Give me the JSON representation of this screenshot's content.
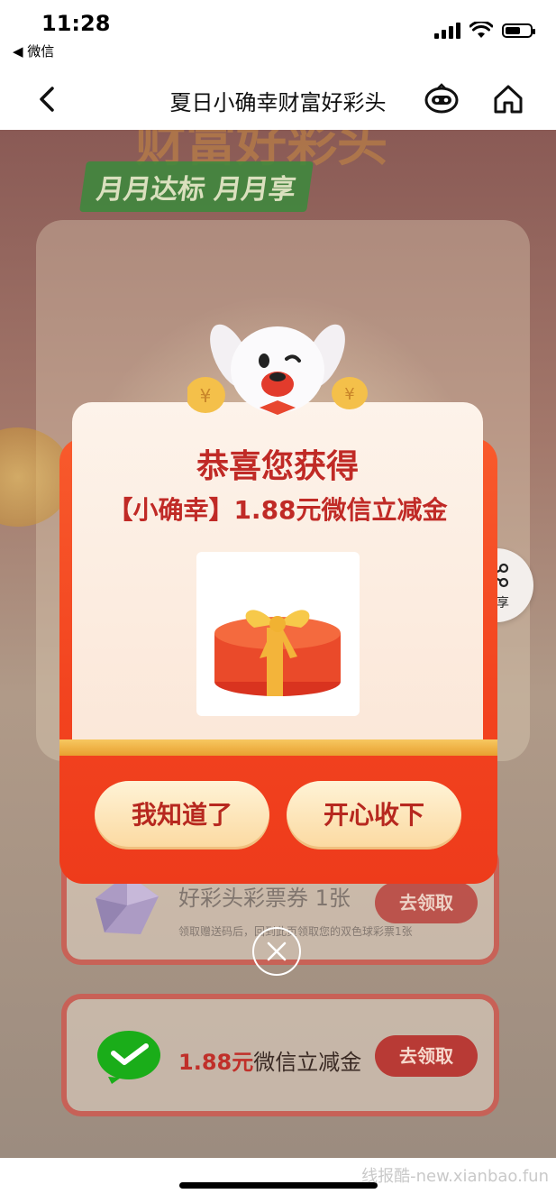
{
  "status_bar": {
    "time": "11:28",
    "back_app": "◀ 微信",
    "battery_level": 0.6
  },
  "nav": {
    "title": "夏日小确幸财富好彩头"
  },
  "background": {
    "banner_title": "财富好彩头",
    "banner_tag": "月月达标 月月享",
    "rows": [
      {
        "title": "好彩头彩票券 1张",
        "subtitle": "领取赠送码后，回到此页领取您的双色球彩票1张",
        "button": "去领取"
      },
      {
        "amount": "1.88元",
        "title": "微信立减金",
        "button": "去领取"
      }
    ]
  },
  "share": {
    "label": "分享"
  },
  "modal": {
    "title": "恭喜您获得",
    "prize": "【小确幸】1.88元微信立减金",
    "buttons": {
      "know": "我知道了",
      "accept": "开心收下"
    }
  },
  "watermark": "线报酷-new.xianbao.fun",
  "colors": {
    "primary_red": "#c02a26",
    "modal_orange": "#f2431f",
    "button_cream": "#fde8c0",
    "wechat_green": "#1aad19"
  }
}
